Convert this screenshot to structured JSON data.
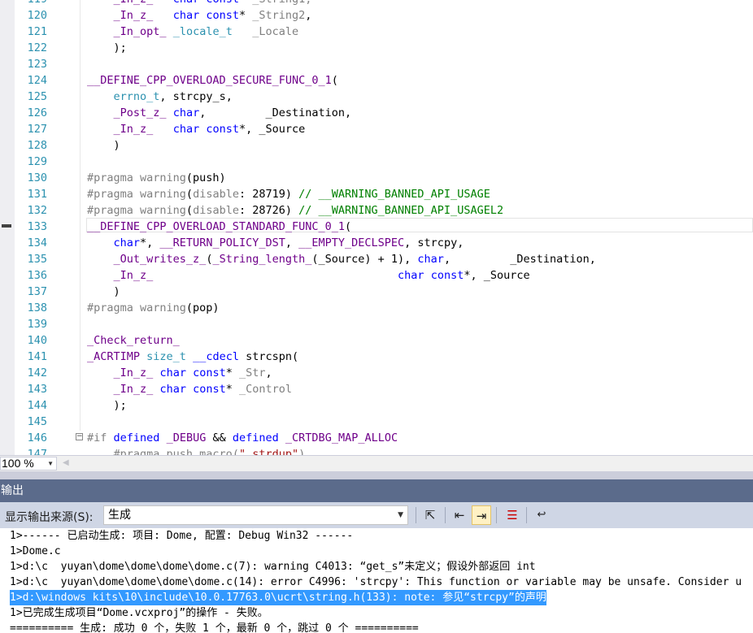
{
  "editor": {
    "zoom": "100 %",
    "lines": [
      {
        "n": "119",
        "html": "    <span class=\"m\">_In_z_</span>   <span class=\"k\">char</span> <span class=\"k\">const</span>* <span class=\"g\">_String1,</span>"
      },
      {
        "n": "120",
        "html": "    <span class=\"m\">_In_z_</span>   <span class=\"k\">char</span> <span class=\"k\">const</span>* <span class=\"g\">_String2</span>,"
      },
      {
        "n": "121",
        "html": "    <span class=\"m\">_In_opt_</span> <span class=\"t\">_locale_t</span>   <span class=\"g\">_Locale</span>"
      },
      {
        "n": "122",
        "html": "    );"
      },
      {
        "n": "123",
        "html": ""
      },
      {
        "n": "124",
        "html": "<span class=\"m\">__DEFINE_CPP_OVERLOAD_SECURE_FUNC_0_1</span>("
      },
      {
        "n": "125",
        "html": "    <span class=\"t\">errno_t</span>, strcpy_s,"
      },
      {
        "n": "126",
        "html": "    <span class=\"m\">_Post_z_</span> <span class=\"k\">char</span>,         _Destination,"
      },
      {
        "n": "127",
        "html": "    <span class=\"m\">_In_z_</span>   <span class=\"k\">char</span> <span class=\"k\">const</span>*, _Source"
      },
      {
        "n": "128",
        "html": "    )"
      },
      {
        "n": "129",
        "html": ""
      },
      {
        "n": "130",
        "html": "<span class=\"p\">#pragma warning</span>(push)"
      },
      {
        "n": "131",
        "html": "<span class=\"p\">#pragma warning</span>(<span class=\"p\">disable</span>: 28719) <span class=\"c\">// __WARNING_BANNED_API_USAGE</span>"
      },
      {
        "n": "132",
        "html": "<span class=\"p\">#pragma warning</span>(<span class=\"p\">disable</span>: 28726) <span class=\"c\">// __WARNING_BANNED_API_USAGEL2</span>"
      },
      {
        "n": "133",
        "html": "<span class=\"m\">__DEFINE_CPP_OVERLOAD_STANDARD_FUNC_0_1</span>("
      },
      {
        "n": "134",
        "html": "    <span class=\"k\">char</span>*, <span class=\"m\">__RETURN_POLICY_DST</span>, <span class=\"m\">__EMPTY_DECLSPEC</span>, strcpy,"
      },
      {
        "n": "135",
        "html": "    <span class=\"m\">_Out_writes_z_</span>(<span class=\"m\">_String_length_</span>(_Source) + 1), <span class=\"k\">char</span>,         _Destination,"
      },
      {
        "n": "136",
        "html": "    <span class=\"m\">_In_z_</span>                                     <span class=\"k\">char</span> <span class=\"k\">const</span>*, _Source"
      },
      {
        "n": "137",
        "html": "    )"
      },
      {
        "n": "138",
        "html": "<span class=\"p\">#pragma warning</span>(pop)"
      },
      {
        "n": "139",
        "html": ""
      },
      {
        "n": "140",
        "html": "<span class=\"m\">_Check_return_</span>"
      },
      {
        "n": "141",
        "html": "<span class=\"m\">_ACRTIMP</span> <span class=\"t\">size_t</span> <span class=\"k\">__cdecl</span> strcspn("
      },
      {
        "n": "142",
        "html": "    <span class=\"m\">_In_z_</span> <span class=\"k\">char</span> <span class=\"k\">const</span>* <span class=\"g\">_Str</span>,"
      },
      {
        "n": "143",
        "html": "    <span class=\"m\">_In_z_</span> <span class=\"k\">char</span> <span class=\"k\">const</span>* <span class=\"g\">_Control</span>"
      },
      {
        "n": "144",
        "html": "    );"
      },
      {
        "n": "145",
        "html": ""
      },
      {
        "n": "146",
        "html": "<span class=\"p\">#if</span> <span class=\"k\">defined</span> <span class=\"m\">_DEBUG</span> &amp;&amp; <span class=\"k\">defined</span> <span class=\"m\">_CRTDBG_MAP_ALLOC</span>"
      },
      {
        "n": "147",
        "html": "    <span class=\"g\">#pragma push_macro(</span><span class=\"s\">\"_strdup\"</span><span class=\"g\">)</span>"
      }
    ]
  },
  "output": {
    "title": "输出",
    "source_label": "显示输出来源(S):",
    "source_value": "生成",
    "lines": [
      "1>------ 已启动生成: 项目: Dome, 配置: Debug Win32 ------",
      "1>Dome.c",
      "1>d:\\c  yuyan\\dome\\dome\\dome\\dome.c(7): warning C4013: “get_s”未定义；假设外部返回 int",
      "1>d:\\c  yuyan\\dome\\dome\\dome\\dome.c(14): error C4996: 'strcpy': This function or variable may be unsafe. Consider u",
      "1>d:\\windows kits\\10\\include\\10.0.17763.0\\ucrt\\string.h(133): note: 参见“strcpy”的声明",
      "1>已完成生成项目“Dome.vcxproj”的操作 - 失败。",
      "========== 生成: 成功 0 个，失败 1 个，最新 0 个，跳过 0 个 =========="
    ]
  }
}
